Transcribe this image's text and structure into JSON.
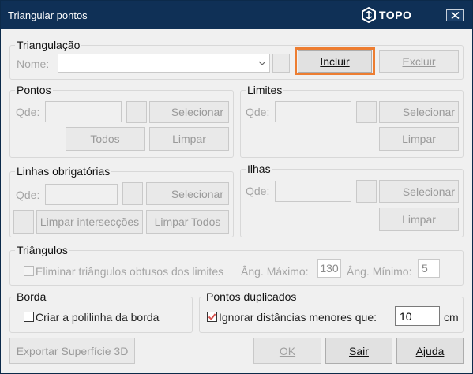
{
  "window": {
    "title": "Triangular pontos",
    "brand": "TOPO",
    "colors": {
      "titlebar": "#0f3056",
      "highlight": "#ed7d31",
      "check": "#d9534f"
    }
  },
  "triangulacao": {
    "legend": "Triangulação",
    "nome_label": "Nome:",
    "nome_value": "",
    "incluir": "Incluir",
    "excluir": "Excluir"
  },
  "pontos": {
    "legend": "Pontos",
    "qde_label": "Qde:",
    "selecionar": "Selecionar",
    "todos": "Todos",
    "limpar": "Limpar"
  },
  "limites": {
    "legend": "Limites",
    "qde_label": "Qde:",
    "selecionar": "Selecionar",
    "limpar": "Limpar"
  },
  "linhas": {
    "legend": "Linhas obrigatórias",
    "qde_label": "Qde:",
    "selecionar": "Selecionar",
    "limpar_interseccoes": "Limpar intersecções",
    "limpar_todos": "Limpar Todos"
  },
  "ilhas": {
    "legend": "Ilhas",
    "qde_label": "Qde:",
    "selecionar": "Selecionar",
    "limpar": "Limpar"
  },
  "triangulos": {
    "legend": "Triângulos",
    "eliminar_label": "Eliminar triângulos obtusos dos limites",
    "eliminar_checked": false,
    "ang_max_label": "Âng. Máximo:",
    "ang_max_value": "130",
    "ang_min_label": "Âng. Mínimo:",
    "ang_min_value": "5"
  },
  "borda": {
    "legend": "Borda",
    "criar_label": "Criar a polilinha da borda",
    "criar_checked": false
  },
  "duplicados": {
    "legend": "Pontos duplicados",
    "ignorar_label": "Ignorar distâncias menores que:",
    "ignorar_checked": true,
    "distance_value": "10",
    "unit": "cm"
  },
  "footer": {
    "exportar": "Exportar Superfície 3D",
    "ok": "OK",
    "sair": "Sair",
    "ajuda": "Ajuda"
  }
}
